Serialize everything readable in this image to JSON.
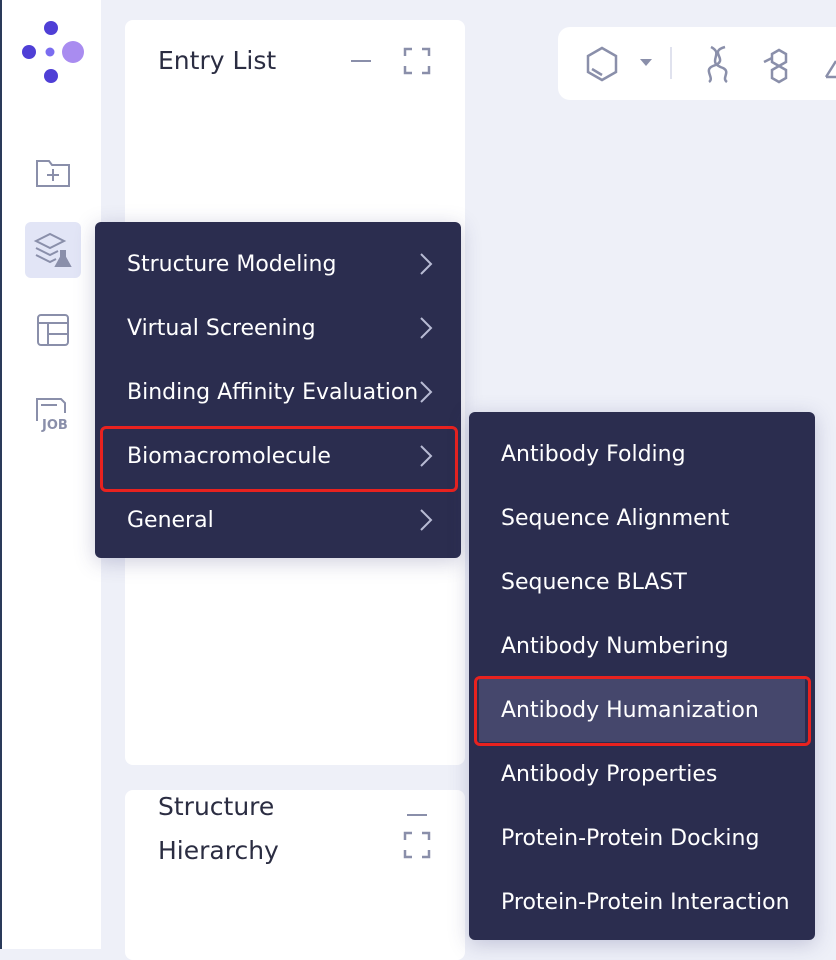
{
  "sidebar": {
    "icons": [
      {
        "name": "new-folder-icon"
      },
      {
        "name": "tools-icon",
        "active": true
      },
      {
        "name": "layout-icon"
      },
      {
        "name": "job-icon",
        "label": "JOB"
      }
    ]
  },
  "entry_list": {
    "title": "Entry List"
  },
  "structure_hierarchy": {
    "title_line1": "Structure",
    "title_line2": "Hierarchy"
  },
  "toolbar": {
    "icons": [
      "hexagon-icon",
      "dropdown-icon",
      "helix-icon",
      "molecule-icon",
      "pencil-icon"
    ]
  },
  "main_menu": {
    "items": [
      {
        "label": "Structure Modeling"
      },
      {
        "label": "Virtual Screening"
      },
      {
        "label": "Binding Affinity Evaluation"
      },
      {
        "label": "Biomacromolecule",
        "highlighted": true
      },
      {
        "label": "General"
      }
    ]
  },
  "sub_menu": {
    "items": [
      {
        "label": "Antibody Folding"
      },
      {
        "label": "Sequence Alignment"
      },
      {
        "label": "Sequence BLAST"
      },
      {
        "label": "Antibody Numbering"
      },
      {
        "label": "Antibody Humanization",
        "highlighted": true
      },
      {
        "label": "Antibody Properties"
      },
      {
        "label": "Protein-Protein Docking"
      },
      {
        "label": "Protein-Protein Interaction"
      }
    ]
  },
  "colors": {
    "menu_bg": "#2b2d4f",
    "highlight": "#e8221f",
    "accent": "#4f3fd6",
    "accent_light": "#a98cf0"
  }
}
